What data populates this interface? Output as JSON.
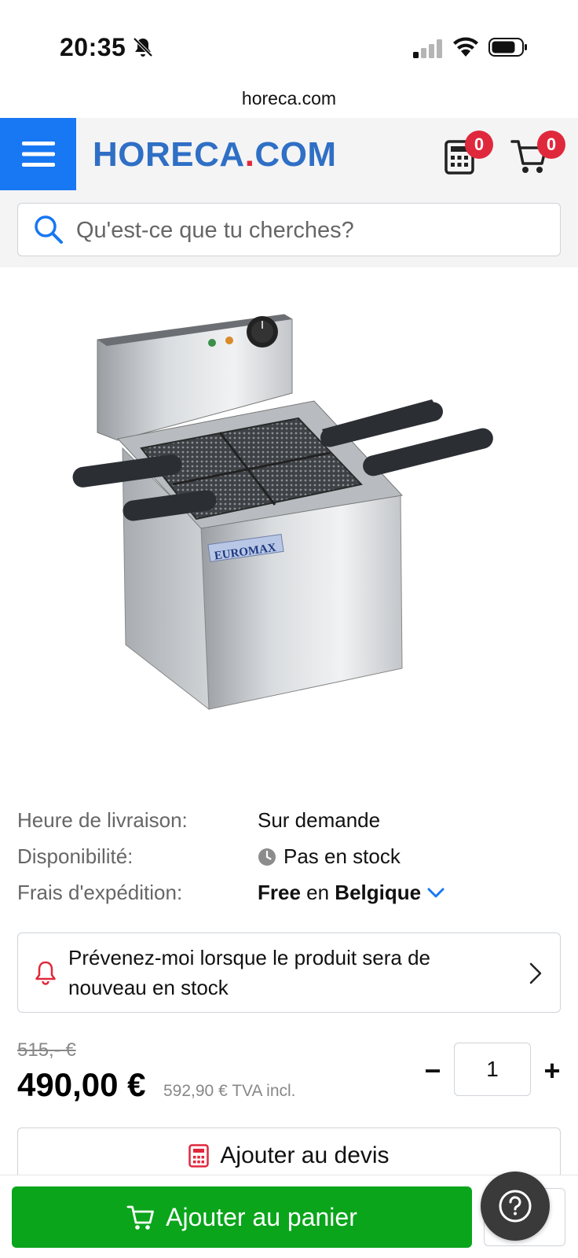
{
  "status_bar": {
    "time": "20:35",
    "icons": [
      "bell-off-icon",
      "signal-icon",
      "wifi-icon",
      "battery-icon"
    ]
  },
  "browser": {
    "url": "horeca.com"
  },
  "header": {
    "logo_main": "HORECA",
    "logo_dot": ".",
    "logo_tld": "COM",
    "quote_count": "0",
    "cart_count": "0",
    "brand_color": "#1877f2",
    "logo_color": "#2f6fc5",
    "badge_color": "#e0283c"
  },
  "search": {
    "placeholder": "Qu'est-ce que tu cherches?"
  },
  "product": {
    "image_brand": "EUROMAX",
    "info": [
      {
        "label": "Heure de livraison:",
        "value": "Sur demande"
      },
      {
        "label": "Disponibilité:",
        "value": "Pas en stock"
      },
      {
        "label": "Frais d'expédition:",
        "value_bold1": "Free",
        "value_mid": " en ",
        "value_bold2": "Belgique"
      }
    ],
    "notify_text": "Prévenez-moi lorsque le produit sera de nouveau en stock",
    "old_price": "515,- €",
    "price": "490,00 €",
    "price_tva": "592,90 € TVA incl.",
    "quantity": "1",
    "qty_minus": "−",
    "qty_plus": "+",
    "quote_label": "Ajouter au devis",
    "cart_label": "Ajouter au panier",
    "cart_button_color": "#0aa51b"
  }
}
